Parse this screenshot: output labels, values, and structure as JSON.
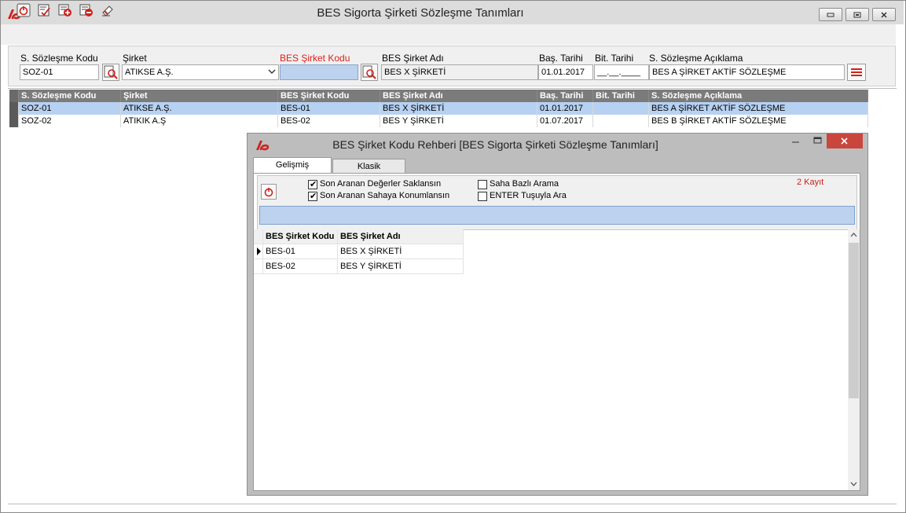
{
  "window": {
    "title": "BES Sigorta Şirketi Sözleşme Tanımları",
    "minimize_icon": "minimize-icon",
    "restore_icon": "restore-icon",
    "close_icon": "close-icon"
  },
  "toolbar": {
    "icons": [
      "power-icon",
      "checklist-icon",
      "add-record-icon",
      "remove-record-icon",
      "eraser-icon"
    ]
  },
  "form": {
    "labels": {
      "contract_code": "S. Sözleşme Kodu",
      "company": "Şirket",
      "bes_company_code": "BES Şirket Kodu",
      "bes_company_name": "BES Şirket Adı",
      "start_date": "Baş. Tarihi",
      "end_date": "Bit. Tarihi",
      "description": "S. Sözleşme Açıklama"
    },
    "values": {
      "contract_code": "SOZ-01",
      "company": "ATIKSE A.Ş.",
      "bes_company_code": "",
      "bes_company_name": "BES X ŞİRKETİ",
      "start_date": "01.01.2017",
      "end_date": "__.__.____",
      "description": "BES A ŞİRKET AKTİF SÖZLEŞME"
    }
  },
  "grid": {
    "columns": [
      "S. Sözleşme Kodu",
      "Şirket",
      "BES Şirket Kodu",
      "BES Şirket Adı",
      "Baş. Tarihi",
      "Bit. Tarihi",
      "S. Sözleşme Açıklama"
    ],
    "rows": [
      [
        "SOZ-01",
        "ATIKSE A.Ş.",
        "BES-01",
        "BES X ŞİRKETİ",
        "01.01.2017",
        "",
        "BES A ŞİRKET AKTİF SÖZLEŞME"
      ],
      [
        "SOZ-02",
        "ATIKIK A.Ş",
        "BES-02",
        "BES Y ŞİRKETİ",
        "01.07.2017",
        "",
        "BES B ŞİRKET AKTİF SÖZLEŞME"
      ]
    ]
  },
  "dialog": {
    "title": "BES Şirket Kodu Rehberi [BES Sigorta Şirketi Sözleşme Tanımları]",
    "tabs": [
      "Gelişmiş",
      "Klasik"
    ],
    "active_tab": "Gelişmiş",
    "options": {
      "keep_last_values": {
        "label": "Son Aranan Değerler Saklansın",
        "checked": true
      },
      "position_last_field": {
        "label": "Son Aranan Sahaya Konumlansın",
        "checked": true
      },
      "field_based_search": {
        "label": "Saha Bazlı Arama",
        "checked": false
      },
      "enter_search": {
        "label": "ENTER Tuşuyla Ara",
        "checked": false
      }
    },
    "record_count": "2 Kayıt",
    "search_value": "",
    "grid": {
      "columns": [
        "BES Şirket Kodu",
        "BES Şirket Adı"
      ],
      "rows": [
        [
          "BES-01",
          "BES X ŞİRKETİ"
        ],
        [
          "BES-02",
          "BES Y ŞİRKETİ"
        ]
      ]
    }
  },
  "colors": {
    "grid_header": "#7b7b7b",
    "selected_row": "#b7d1f2",
    "required_label": "#e0201a",
    "close_button": "#c9463d"
  }
}
